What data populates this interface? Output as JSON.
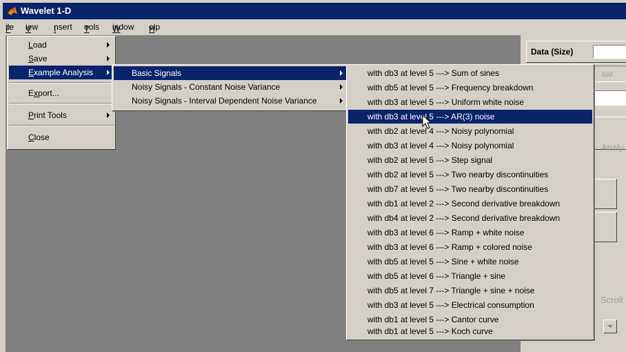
{
  "window": {
    "title": "Wavelet 1-D"
  },
  "menubar": [
    "File",
    "View",
    "Insert",
    "Tools",
    "Window",
    "Help"
  ],
  "file_menu": [
    "Load",
    "Save",
    "Example Analysis",
    "Export...",
    "Print Tools",
    "Close"
  ],
  "example_menu": [
    "Basic Signals",
    "Noisy Signals - Constant Noise Variance",
    "Noisy Signals - Interval Dependent Noise Variance"
  ],
  "basic_signals": [
    "with db3 at level 5 ---> Sum of sines",
    "with db5 at level 5 ---> Frequency breakdown",
    "with db3 at level 5 ---> Uniform white noise",
    "with db3 at level 5 ---> AR(3) noise",
    "with db2 at level 4 ---> Noisy polynomial",
    "with db3 at level 4 ---> Noisy polynomial",
    "with db2 at level 5 ---> Step signal",
    "with db2 at level 5 ---> Two nearby discontinuities",
    "with db7 at level 5 ---> Two nearby discontinuities",
    "with db1 at level 2 ---> Second derivative breakdown",
    "with db4 at level 2 ---> Second derivative breakdown",
    "with db3 at level 6 ---> Ramp + white noise",
    "with db3 at level 6 ---> Ramp + colored noise",
    "with db5 at level 5 ---> Sine + white noise",
    "with db5 at level 6 ---> Triangle + sine",
    "with db5 at level 7 ---> Triangle + sine + noise",
    "with db3 at level 5 ---> Electrical consumption",
    "with db1 at level 5 ---> Cantor curve",
    "with db1 at level 5 ---> Koch curve"
  ],
  "right_panel": {
    "data_label": "Data (Size)",
    "wavelet_partial": "aar",
    "analyze_partial": "Analy",
    "scroll_partial": "Scroll"
  }
}
